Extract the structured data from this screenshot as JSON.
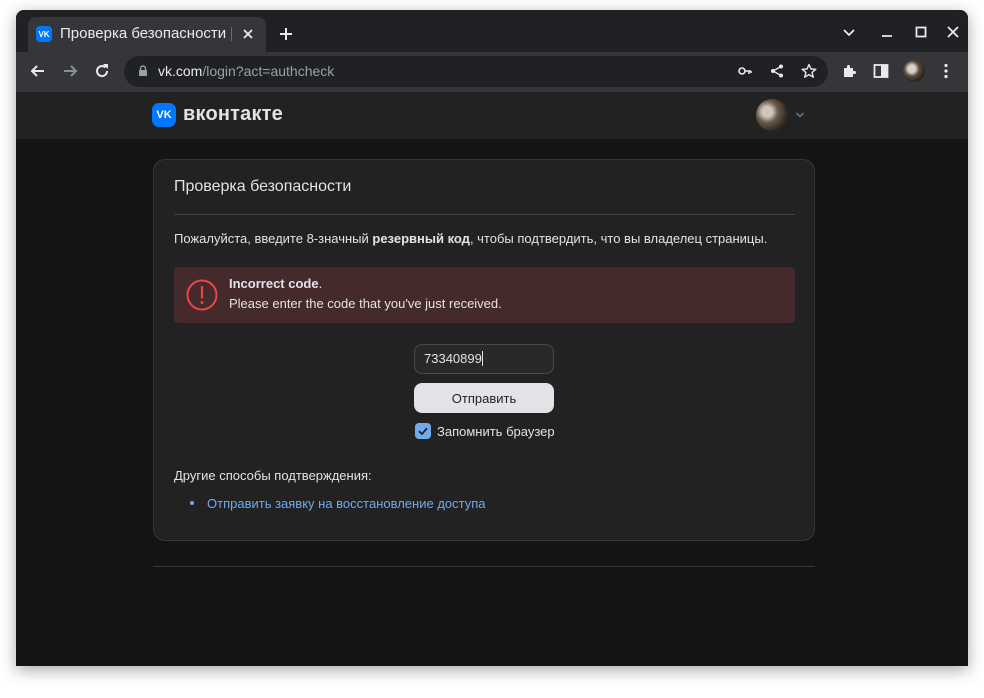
{
  "browser": {
    "tab": {
      "title": "Проверка безопасности | ВКонтакте",
      "favicon": "vk-favicon-icon"
    },
    "address_bar": {
      "host": "vk.com",
      "path": "/login?act=authcheck"
    }
  },
  "header": {
    "logo_text": "вконтакте"
  },
  "card": {
    "title": "Проверка безопасности",
    "instruction_prefix": "Пожалуйста, введите 8-значный ",
    "instruction_bold": "резервный код",
    "instruction_suffix": ", чтобы подтвердить, что вы владелец страницы.",
    "error": {
      "title": "Incorrect code",
      "title_suffix": ".",
      "message": "Please enter the code that you've just received."
    },
    "code_input": {
      "value": "73340899"
    },
    "submit_label": "Отправить",
    "remember": {
      "label": "Запомнить браузер",
      "checked": true
    },
    "other_methods": {
      "heading": "Другие способы подтверждения:",
      "links": [
        "Отправить заявку на восстановление доступа"
      ]
    }
  },
  "colors": {
    "accent": "#71aaeb",
    "vk_blue": "#0077ff",
    "error_bg": "#452a2c",
    "error_icon": "#e64646",
    "page_bg": "#141414",
    "card_bg": "#222222"
  }
}
